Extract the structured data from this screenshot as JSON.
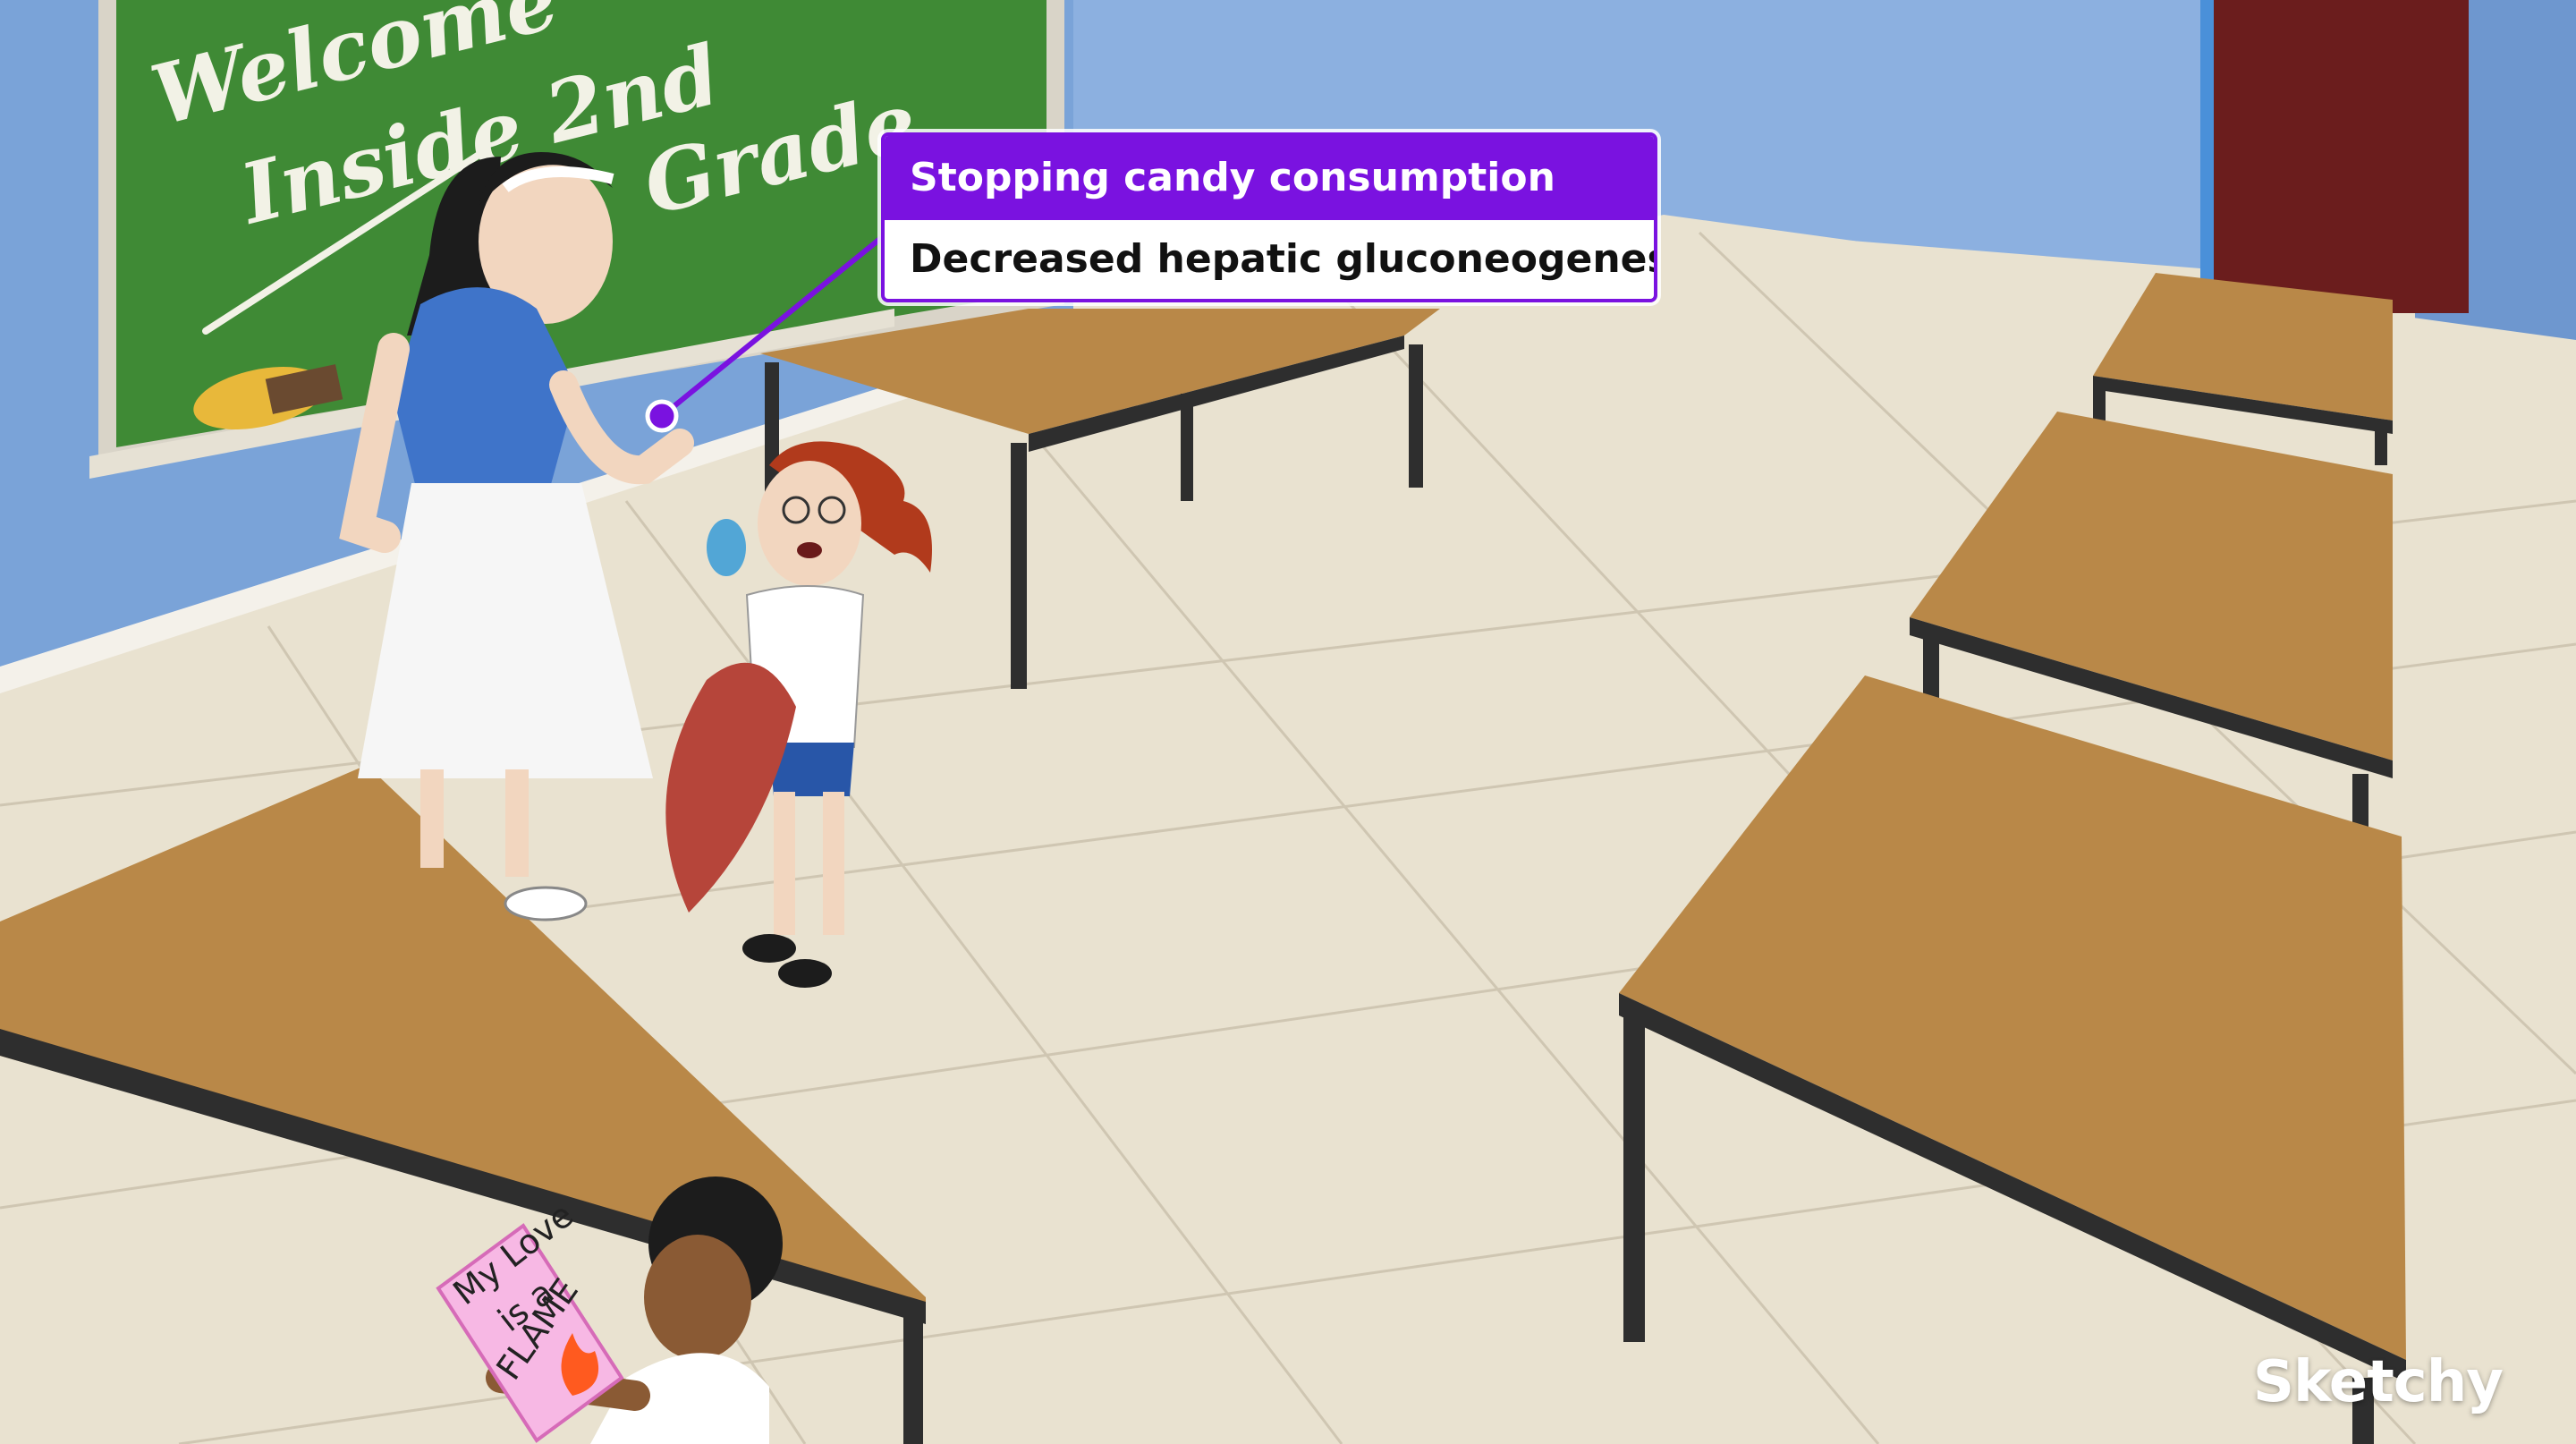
{
  "scene": {
    "chalkboard_text": [
      "Welcome",
      "Inside",
      "2nd",
      "Grade"
    ],
    "card_text": [
      "My Love",
      "is a",
      "FLAME"
    ]
  },
  "callout": {
    "heading": "Stopping candy consumption",
    "body": "Decreased hepatic gluconeogenesis"
  },
  "brand": "Sketchy",
  "colors": {
    "accent": "#7a12e0",
    "chalkboard": "#3f8a35",
    "wall": "#7aa3d8",
    "floor": "#e9e2d0",
    "desk_top": "#b98848"
  }
}
